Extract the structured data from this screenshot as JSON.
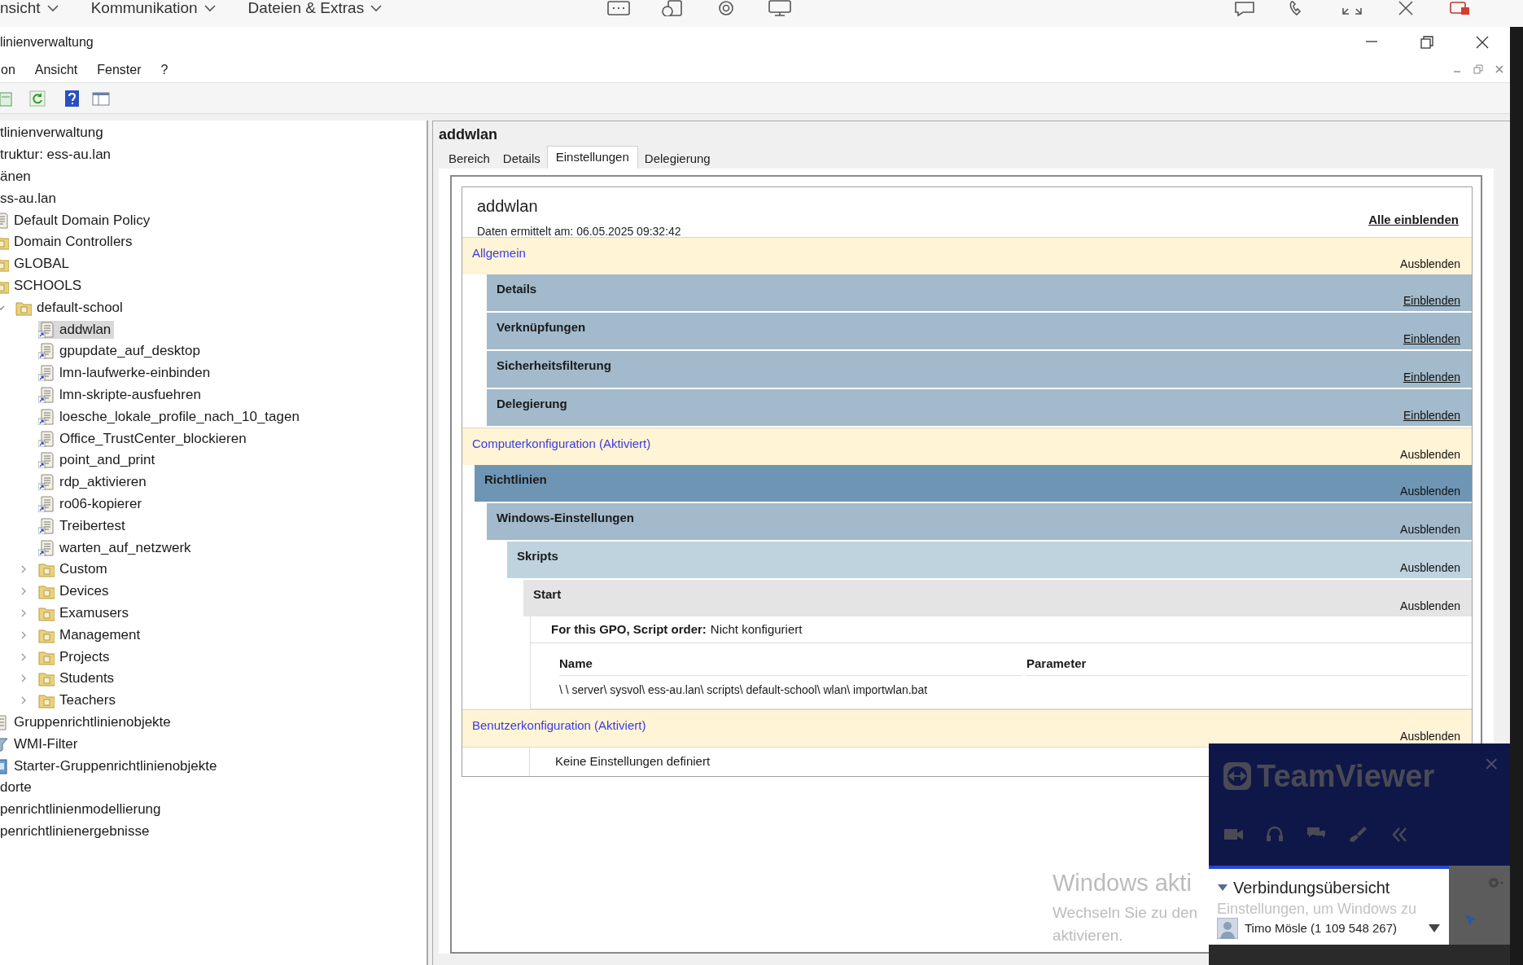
{
  "remote_toolbar": {
    "menus": [
      {
        "label": "nsicht"
      },
      {
        "label": "Kommunikation"
      },
      {
        "label": "Dateien & Extras"
      }
    ]
  },
  "window": {
    "title": "linienverwaltung"
  },
  "menu_bar": [
    "on",
    "Ansicht",
    "Fenster",
    "?"
  ],
  "tree": [
    {
      "label": "tlinienverwaltung",
      "selected": false,
      "children": [
        {
          "label": "truktur: ess-au.lan",
          "selected": false,
          "children": [
            {
              "label": "änen",
              "selected": false,
              "children": [
                {
                  "label": "ss-au.lan",
                  "selected": false,
                  "children": [
                    {
                      "label": "Default Domain Policy",
                      "kind": "gpo",
                      "selected": false
                    },
                    {
                      "label": "Domain Controllers",
                      "kind": "ou",
                      "selected": false
                    },
                    {
                      "label": "GLOBAL",
                      "kind": "ou",
                      "selected": false
                    },
                    {
                      "label": "SCHOOLS",
                      "kind": "ou",
                      "selected": false,
                      "children": [
                        {
                          "label": "default-school",
                          "kind": "ou",
                          "expanded": true,
                          "selected": false,
                          "children": [
                            {
                              "label": "addwlan",
                              "kind": "gpo",
                              "selected": true
                            },
                            {
                              "label": "gpupdate_auf_desktop",
                              "kind": "gpo",
                              "selected": false
                            },
                            {
                              "label": "lmn-laufwerke-einbinden",
                              "kind": "gpo",
                              "selected": false
                            },
                            {
                              "label": "lmn-skripte-ausfuehren",
                              "kind": "gpo",
                              "selected": false
                            },
                            {
                              "label": "loesche_lokale_profile_nach_10_tagen",
                              "kind": "gpo",
                              "selected": false
                            },
                            {
                              "label": "Office_TrustCenter_blockieren",
                              "kind": "gpo",
                              "selected": false
                            },
                            {
                              "label": "point_and_print",
                              "kind": "gpo",
                              "selected": false
                            },
                            {
                              "label": "rdp_aktivieren",
                              "kind": "gpo",
                              "selected": false
                            },
                            {
                              "label": "ro06-kopierer",
                              "kind": "gpo",
                              "selected": false
                            },
                            {
                              "label": "Treibertest",
                              "kind": "gpo",
                              "selected": false
                            },
                            {
                              "label": "warten_auf_netzwerk",
                              "kind": "gpo",
                              "selected": false
                            },
                            {
                              "label": "Custom",
                              "kind": "ou",
                              "expanded": false,
                              "selected": false
                            },
                            {
                              "label": "Devices",
                              "kind": "ou",
                              "expanded": false,
                              "selected": false
                            },
                            {
                              "label": "Examusers",
                              "kind": "ou",
                              "expanded": false,
                              "selected": false
                            },
                            {
                              "label": "Management",
                              "kind": "ou",
                              "expanded": false,
                              "selected": false
                            },
                            {
                              "label": "Projects",
                              "kind": "ou",
                              "expanded": false,
                              "selected": false
                            },
                            {
                              "label": "Students",
                              "kind": "ou",
                              "expanded": false,
                              "selected": false
                            },
                            {
                              "label": "Teachers",
                              "kind": "ou",
                              "expanded": false,
                              "selected": false
                            }
                          ]
                        }
                      ]
                    },
                    {
                      "label": "Gruppenrichtlinienobjekte",
                      "kind": "container",
                      "selected": false
                    },
                    {
                      "label": "WMI-Filter",
                      "kind": "filter",
                      "selected": false
                    },
                    {
                      "label": "Starter-Gruppenrichtlinienobjekte",
                      "kind": "starter",
                      "selected": false
                    }
                  ]
                }
              ]
            },
            {
              "label": "dorte",
              "selected": false
            }
          ]
        },
        {
          "label": "penrichtlinienmodellierung",
          "selected": false
        },
        {
          "label": "penrichtlinienergebnisse",
          "selected": false
        }
      ]
    }
  ],
  "details": {
    "title": "addwlan",
    "tabs": [
      {
        "label": "Bereich",
        "selected": false
      },
      {
        "label": "Details",
        "selected": false
      },
      {
        "label": "Einstellungen",
        "selected": true
      },
      {
        "label": "Delegierung",
        "selected": false
      }
    ],
    "report": {
      "title": "addwlan",
      "collected": "Daten ermittelt am: 06.05.2025 09:32:42",
      "show_all": "Alle einblenden",
      "sections": [
        {
          "kind": "category",
          "title": "Allgemein",
          "toggle": "Ausblenden",
          "expanded": true,
          "children": [
            {
              "kind": "summary",
              "title": "Details",
              "toggle": "Einblenden",
              "expanded": false
            },
            {
              "kind": "summary",
              "title": "Verknüpfungen",
              "toggle": "Einblenden",
              "expanded": false
            },
            {
              "kind": "summary",
              "title": "Sicherheitsfilterung",
              "toggle": "Einblenden",
              "expanded": false
            },
            {
              "kind": "summary",
              "title": "Delegierung",
              "toggle": "Einblenden",
              "expanded": false
            }
          ]
        },
        {
          "kind": "category",
          "title": "Computerkonfiguration (Aktiviert)",
          "toggle": "Ausblenden",
          "expanded": true,
          "children": [
            {
              "kind": "group",
              "title": "Richtlinien",
              "toggle": "Ausblenden",
              "expanded": true,
              "children": [
                {
                  "kind": "group",
                  "title": "Windows-Einstellungen",
                  "toggle": "Ausblenden",
                  "expanded": true,
                  "children": [
                    {
                      "kind": "group",
                      "title": "Skripts",
                      "toggle": "Ausblenden",
                      "expanded": true,
                      "children": [
                        {
                          "kind": "group",
                          "title": "Start",
                          "toggle": "Ausblenden",
                          "expanded": true,
                          "children": [
                            {
                              "kind": "setting",
                              "label": "For this GPO, Script order:",
                              "value": "Nicht konfiguriert"
                            },
                            {
                              "kind": "table",
                              "columns": [
                                "Name",
                                "Parameter"
                              ],
                              "rows": [
                                [
                                  "\\ \\ server\\ sysvol\\ ess-au.lan\\ scripts\\ default-school\\ wlan\\ importwlan.bat"
                                ]
                              ]
                            }
                          ]
                        }
                      ]
                    }
                  ]
                }
              ]
            }
          ]
        },
        {
          "kind": "category",
          "title": "Benutzerkonfiguration (Aktiviert)",
          "toggle": "Ausblenden",
          "expanded": true,
          "children": [
            {
              "kind": "note",
              "text": "Keine Einstellungen definiert"
            }
          ]
        }
      ]
    }
  },
  "watermark": {
    "title": "Windows akti",
    "line_1": "Wechseln Sie zu den",
    "line_2": "aktivieren."
  },
  "teamviewer": {
    "brand": "TeamViewer",
    "close": "×",
    "overview": "Verbindungsübersicht",
    "watermark_part": "Einstellungen, um Windows zu",
    "partner": "Timo Mösle (1 109 548 267)"
  }
}
